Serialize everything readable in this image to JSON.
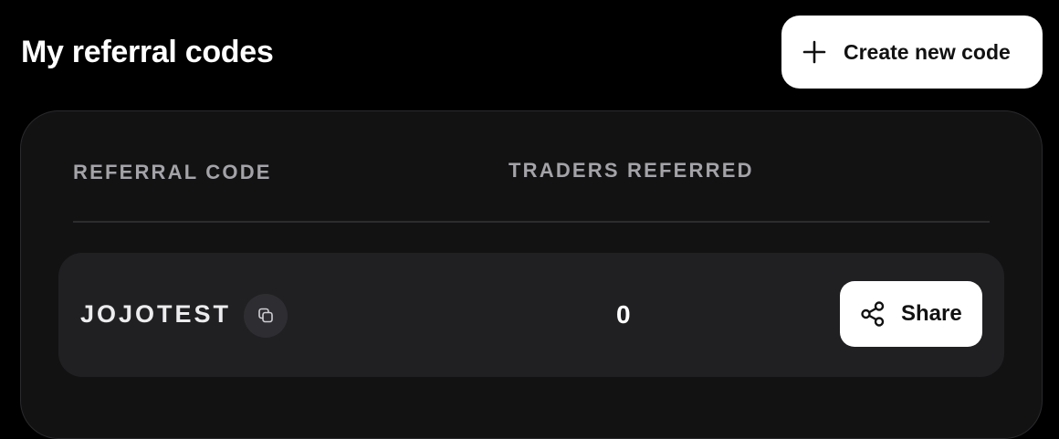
{
  "header": {
    "title": "My referral codes",
    "create_button_label": "Create new code",
    "create_button_icon": "plus-icon"
  },
  "table": {
    "columns": [
      "REFERRAL CODE",
      "TRADERS REFERRED"
    ],
    "rows": [
      {
        "code": "JOJOTEST",
        "copy_icon": "copy-icon",
        "traders_referred": "0",
        "share_label": "Share",
        "share_icon": "share-icon"
      }
    ]
  },
  "colors": {
    "background": "#000000",
    "card": "#121213",
    "row": "#202023",
    "button": "#ffffff",
    "header_text": "#a3a3a8"
  }
}
